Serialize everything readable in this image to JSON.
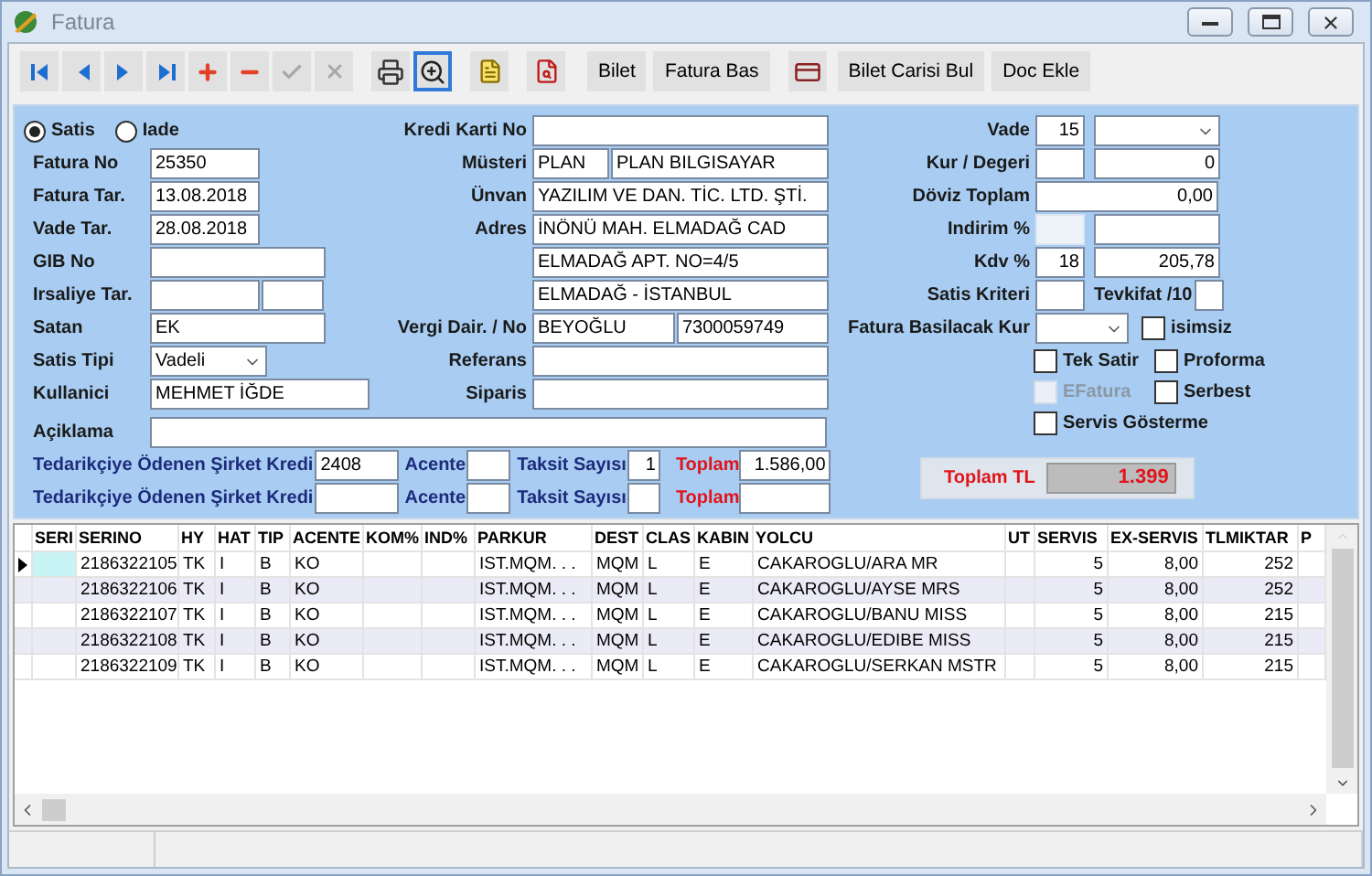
{
  "window": {
    "title": "Fatura"
  },
  "toolbar": [
    {
      "kind": "icon",
      "disabled": false,
      "focused": false
    },
    {
      "kind": "icon",
      "disabled": false,
      "focused": false
    },
    {
      "kind": "icon",
      "disabled": false,
      "focused": false
    },
    {
      "kind": "icon",
      "disabled": false,
      "focused": false
    },
    {
      "kind": "icon",
      "disabled": false,
      "focused": false
    },
    {
      "kind": "icon",
      "disabled": false,
      "focused": false
    },
    {
      "kind": "icon",
      "disabled": true,
      "focused": false
    },
    {
      "kind": "icon",
      "disabled": true,
      "focused": false
    },
    {
      "kind": "icon",
      "disabled": false,
      "focused": false
    },
    {
      "kind": "icon",
      "disabled": false,
      "focused": true
    },
    {
      "kind": "icon",
      "disabled": false,
      "focused": false
    },
    {
      "kind": "icon",
      "disabled": false,
      "focused": false
    },
    {
      "kind": "text",
      "label": "Bilet",
      "disabled": false,
      "focused": false
    },
    {
      "kind": "text",
      "label": "Fatura Bas",
      "disabled": false,
      "focused": false
    },
    {
      "kind": "icon",
      "disabled": false,
      "focused": false
    },
    {
      "kind": "text",
      "label": "Bilet Carisi Bul",
      "disabled": false,
      "focused": false
    },
    {
      "kind": "text",
      "label": "Doc Ekle",
      "disabled": false,
      "focused": false
    }
  ],
  "sale_type": [
    {
      "label": "Satis",
      "selected": true
    },
    {
      "label": "Iade",
      "selected": false
    }
  ],
  "left_fields": [
    {
      "label": "Fatura No",
      "value": "25350"
    },
    {
      "label": "Fatura Tar.",
      "value": "13.08.2018"
    },
    {
      "label": "Vade Tar.",
      "value": "28.08.2018"
    },
    {
      "label": "GIB No"
    },
    {
      "label": "Irsaliye Tar."
    },
    {
      "label": "Satan",
      "value": "EK"
    },
    {
      "label": "Satis Tipi",
      "value": "Vadeli"
    },
    {
      "label": "Kullanici",
      "value": "MEHMET İĞDE"
    }
  ],
  "middle_fields": [
    {
      "label": "Kredi Karti No"
    },
    {
      "label": "Müsteri",
      "value": "PLAN",
      "value_2": "PLAN BILGISAYAR"
    },
    {
      "label": "Ünvan",
      "value": "YAZILIM VE DAN. TİC. LTD. ŞTİ."
    },
    {
      "label": "Adres",
      "value": "İNÖNÜ MAH. ELMADAĞ CAD"
    },
    {
      "value": "ELMADAĞ APT. NO=4/5"
    },
    {
      "value": "ELMADAĞ - İSTANBUL"
    },
    {
      "label": "Vergi Dair. / No",
      "value": "BEYOĞLU",
      "value_2": "7300059749"
    },
    {
      "label": "Referans"
    },
    {
      "label": "Siparis"
    }
  ],
  "description": {
    "label": "Açiklama"
  },
  "supplier_rows": [
    {
      "label": "Tedarikçiye Ödenen Şirket Kredi",
      "value": "2408",
      "agent_label": "Acente",
      "installments_label": "Taksit Sayısı",
      "installments": "1",
      "total_label": "Toplam",
      "total": "1.586,00"
    },
    {
      "label": "Tedarikçiye Ödenen Şirket Kredi",
      "agent_label": "Acente",
      "installments_label": "Taksit Sayısı",
      "total_label": "Toplam"
    }
  ],
  "right_fields": [
    {
      "label": "Vade",
      "value": "15",
      "disabled": false
    },
    {
      "label": "Kur / Degeri",
      "value_2": "0",
      "disabled": false
    },
    {
      "label": "Döviz Toplam",
      "value": "0,00",
      "disabled": false
    },
    {
      "label": "Indirim %",
      "disabled": true
    },
    {
      "label": "Kdv %",
      "value": "18",
      "value_2": "205,78",
      "disabled": false
    },
    {
      "label": "Satis Kriteri",
      "label_2": "Tevkifat /10",
      "disabled": false
    },
    {
      "label": "Fatura Basilacak Kur",
      "disabled": false
    }
  ],
  "options": [
    {
      "label": "isimsiz",
      "checked": false,
      "disabled": false
    },
    {
      "label": "Tek Satir",
      "checked": false,
      "disabled": false
    },
    {
      "label": "Proforma",
      "checked": false,
      "disabled": false
    },
    {
      "label": "EFatura",
      "checked": false,
      "disabled": true
    },
    {
      "label": "Serbest",
      "checked": false,
      "disabled": false
    },
    {
      "label": "Servis Gösterme",
      "checked": false,
      "disabled": false
    }
  ],
  "total": {
    "label": "Toplam TL",
    "value": "1.399"
  },
  "table": {
    "columns": [
      "SERI",
      "SERINO",
      "HY",
      "HAT",
      "TIP",
      "ACENTE",
      "KOM%",
      "IND%",
      "PARKUR",
      "DEST",
      "CLAS",
      "KABIN",
      "YOLCU",
      "UT",
      "SERVIS",
      "EX-SERVIS",
      "TLMIKTAR",
      "P"
    ],
    "rows": [
      {
        "selected": true,
        "serino": "2186322105",
        "hy": "TK",
        "hat": "I",
        "tip": "B",
        "acente": "KO",
        "parkur": "IST.MQM.  .  .",
        "dest": "MQM",
        "clas": "L",
        "kabin": "E",
        "yolcu": "CAKAROGLU/ARA MR",
        "servis": "5",
        "exservis": "8,00",
        "tlmiktar": "252"
      },
      {
        "selected": false,
        "serino": "2186322106",
        "hy": "TK",
        "hat": "I",
        "tip": "B",
        "acente": "KO",
        "parkur": "IST.MQM.  .  .",
        "dest": "MQM",
        "clas": "L",
        "kabin": "E",
        "yolcu": "CAKAROGLU/AYSE MRS",
        "servis": "5",
        "exservis": "8,00",
        "tlmiktar": "252"
      },
      {
        "selected": false,
        "serino": "2186322107",
        "hy": "TK",
        "hat": "I",
        "tip": "B",
        "acente": "KO",
        "parkur": "IST.MQM.  .  .",
        "dest": "MQM",
        "clas": "L",
        "kabin": "E",
        "yolcu": "CAKAROGLU/BANU MISS",
        "servis": "5",
        "exservis": "8,00",
        "tlmiktar": "215"
      },
      {
        "selected": false,
        "serino": "2186322108",
        "hy": "TK",
        "hat": "I",
        "tip": "B",
        "acente": "KO",
        "parkur": "IST.MQM.  .  .",
        "dest": "MQM",
        "clas": "L",
        "kabin": "E",
        "yolcu": "CAKAROGLU/EDIBE MISS",
        "servis": "5",
        "exservis": "8,00",
        "tlmiktar": "215"
      },
      {
        "selected": false,
        "serino": "2186322109",
        "hy": "TK",
        "hat": "I",
        "tip": "B",
        "acente": "KO",
        "parkur": "IST.MQM.  .  .",
        "dest": "MQM",
        "clas": "L",
        "kabin": "E",
        "yolcu": "CAKAROGLU/SERKAN MSTR",
        "servis": "5",
        "exservis": "8,00",
        "tlmiktar": "215"
      }
    ]
  }
}
